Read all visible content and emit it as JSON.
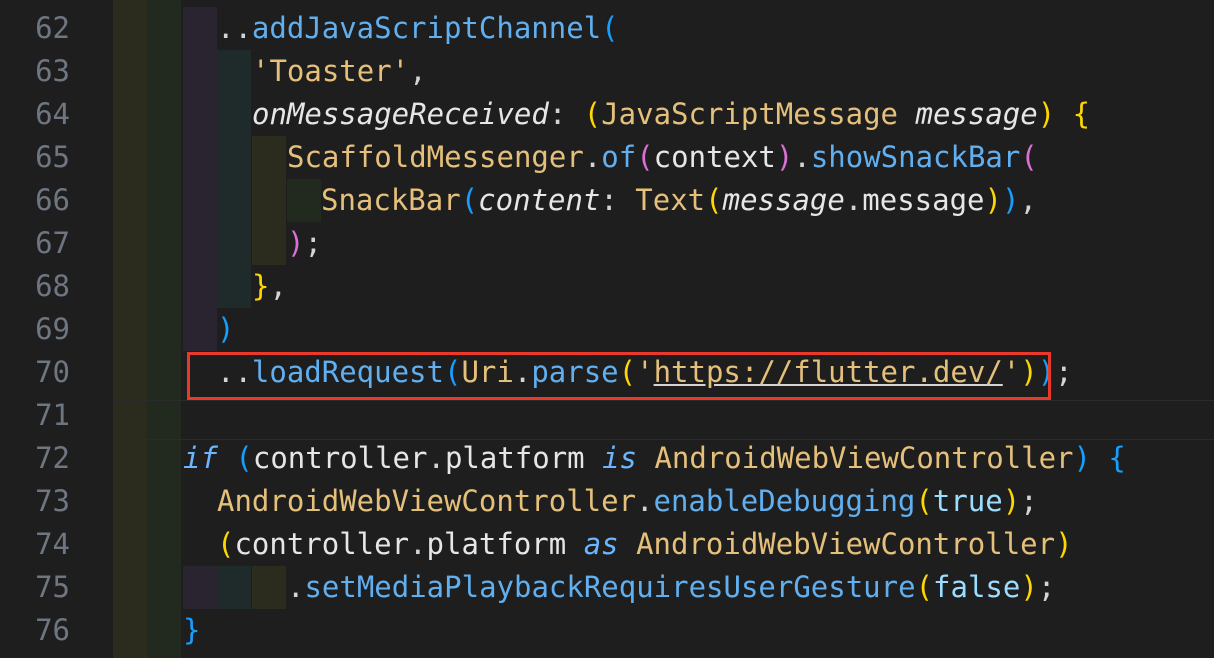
{
  "editor": {
    "lines": [
      {
        "num": "62",
        "tokens": [
          {
            "t": "..",
            "c": "t-punct"
          },
          {
            "t": "addJavaScriptChannel",
            "c": "t-method"
          },
          {
            "t": "(",
            "c": "t-paren-b"
          }
        ]
      },
      {
        "num": "63",
        "tokens": [
          {
            "t": "'Toaster'",
            "c": "t-string2"
          },
          {
            "t": ",",
            "c": "t-punct"
          }
        ]
      },
      {
        "num": "64",
        "tokens": [
          {
            "t": "onMessageReceived",
            "c": "t-param"
          },
          {
            "t": ": ",
            "c": "t-punct"
          },
          {
            "t": "(",
            "c": "t-paren-y"
          },
          {
            "t": "JavaScriptMessage ",
            "c": "t-type"
          },
          {
            "t": "message",
            "c": "t-param"
          },
          {
            "t": ") ",
            "c": "t-paren-y"
          },
          {
            "t": "{",
            "c": "t-paren-y"
          }
        ]
      },
      {
        "num": "65",
        "tokens": [
          {
            "t": "ScaffoldMessenger",
            "c": "t-type"
          },
          {
            "t": ".",
            "c": "t-punct"
          },
          {
            "t": "of",
            "c": "t-method"
          },
          {
            "t": "(",
            "c": "t-paren-p"
          },
          {
            "t": "context",
            "c": "t-ident"
          },
          {
            "t": ")",
            "c": "t-paren-p"
          },
          {
            "t": ".",
            "c": "t-punct"
          },
          {
            "t": "showSnackBar",
            "c": "t-method"
          },
          {
            "t": "(",
            "c": "t-paren-p"
          }
        ]
      },
      {
        "num": "66",
        "tokens": [
          {
            "t": "SnackBar",
            "c": "t-type"
          },
          {
            "t": "(",
            "c": "t-paren-b"
          },
          {
            "t": "content",
            "c": "t-param"
          },
          {
            "t": ": ",
            "c": "t-punct"
          },
          {
            "t": "Text",
            "c": "t-type"
          },
          {
            "t": "(",
            "c": "t-paren-y"
          },
          {
            "t": "message",
            "c": "t-param"
          },
          {
            "t": ".",
            "c": "t-punct"
          },
          {
            "t": "message",
            "c": "t-ident"
          },
          {
            "t": ")",
            "c": "t-paren-y"
          },
          {
            "t": ")",
            "c": "t-paren-b"
          },
          {
            "t": ",",
            "c": "t-punct"
          }
        ]
      },
      {
        "num": "67",
        "tokens": [
          {
            "t": ")",
            "c": "t-paren-p"
          },
          {
            "t": ";",
            "c": "t-punct"
          }
        ]
      },
      {
        "num": "68",
        "tokens": [
          {
            "t": "}",
            "c": "t-paren-y"
          },
          {
            "t": ",",
            "c": "t-punct"
          }
        ]
      },
      {
        "num": "69",
        "tokens": [
          {
            "t": ")",
            "c": "t-paren-b"
          }
        ]
      },
      {
        "num": "70",
        "tokens": [
          {
            "t": "..",
            "c": "t-punct"
          },
          {
            "t": "loadRequest",
            "c": "t-method"
          },
          {
            "t": "(",
            "c": "t-paren-b"
          },
          {
            "t": "Uri",
            "c": "t-type"
          },
          {
            "t": ".",
            "c": "t-punct"
          },
          {
            "t": "parse",
            "c": "t-method"
          },
          {
            "t": "(",
            "c": "t-paren-y"
          },
          {
            "t": "'",
            "c": "t-string2"
          },
          {
            "t": "https://flutter.dev/",
            "c": "t-url"
          },
          {
            "t": "'",
            "c": "t-string2"
          },
          {
            "t": ")",
            "c": "t-paren-y"
          },
          {
            "t": ")",
            "c": "t-paren-b"
          },
          {
            "t": ";",
            "c": "t-punct"
          }
        ]
      },
      {
        "num": "71",
        "tokens": []
      },
      {
        "num": "72",
        "tokens": [
          {
            "t": "if",
            "c": "t-kw"
          },
          {
            "t": " ",
            "c": "t-punct"
          },
          {
            "t": "(",
            "c": "t-paren-b"
          },
          {
            "t": "controller",
            "c": "t-ident"
          },
          {
            "t": ".",
            "c": "t-punct"
          },
          {
            "t": "platform ",
            "c": "t-ident"
          },
          {
            "t": "is",
            "c": "t-kw"
          },
          {
            "t": " AndroidWebViewController",
            "c": "t-type"
          },
          {
            "t": ") ",
            "c": "t-paren-b"
          },
          {
            "t": "{",
            "c": "t-paren-b"
          }
        ]
      },
      {
        "num": "73",
        "tokens": [
          {
            "t": "AndroidWebViewController",
            "c": "t-type"
          },
          {
            "t": ".",
            "c": "t-punct"
          },
          {
            "t": "enableDebugging",
            "c": "t-method"
          },
          {
            "t": "(",
            "c": "t-paren-y"
          },
          {
            "t": "true",
            "c": "t-bool"
          },
          {
            "t": ")",
            "c": "t-paren-y"
          },
          {
            "t": ";",
            "c": "t-punct"
          }
        ]
      },
      {
        "num": "74",
        "tokens": [
          {
            "t": "(",
            "c": "t-paren-y"
          },
          {
            "t": "controller",
            "c": "t-ident"
          },
          {
            "t": ".",
            "c": "t-punct"
          },
          {
            "t": "platform ",
            "c": "t-ident"
          },
          {
            "t": "as",
            "c": "t-kw"
          },
          {
            "t": " AndroidWebViewController",
            "c": "t-type"
          },
          {
            "t": ")",
            "c": "t-paren-y"
          }
        ]
      },
      {
        "num": "75",
        "tokens": [
          {
            "t": ".",
            "c": "t-punct"
          },
          {
            "t": "setMediaPlaybackRequiresUserGesture",
            "c": "t-method"
          },
          {
            "t": "(",
            "c": "t-paren-y"
          },
          {
            "t": "false",
            "c": "t-bool"
          },
          {
            "t": ")",
            "c": "t-paren-y"
          },
          {
            "t": ";",
            "c": "t-punct"
          }
        ]
      },
      {
        "num": "76",
        "tokens": [
          {
            "t": "}",
            "c": "t-paren-b"
          }
        ]
      }
    ],
    "highlight_color": "#e8392a"
  }
}
